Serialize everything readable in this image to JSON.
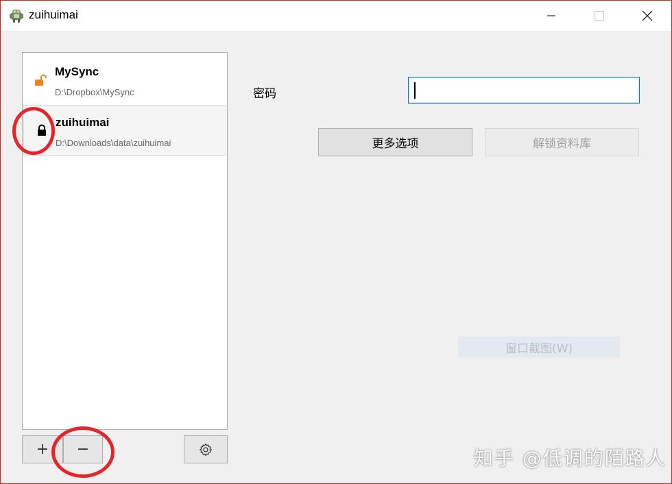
{
  "window": {
    "title": "zuihuimai",
    "border_color": "#c42b1c",
    "icons": {
      "app": "android-robot-icon",
      "minimize": "minimize-icon",
      "maximize": "maximize-icon",
      "close": "close-icon"
    }
  },
  "libraries": [
    {
      "name": "MySync",
      "path": "D:\\Dropbox\\MySync",
      "icon": "unlocked-icon",
      "icon_color": "#e8851c",
      "selected": false
    },
    {
      "name": "zuihuimai",
      "path": "D:\\Downloads\\data\\zuihuimai",
      "icon": "locked-icon",
      "icon_color": "#000000",
      "selected": true
    }
  ],
  "toolbar": {
    "add_label": "+",
    "remove_label": "−",
    "settings_icon": "gear-icon"
  },
  "form": {
    "password_label": "密码",
    "password_value": "",
    "more_options_label": "更多选项",
    "unlock_label": "解锁资料库",
    "accent_color": "#0078d7"
  },
  "overlay": {
    "screenshot_tip": "窗口截图(W)",
    "watermark": "知乎 @低调的陌路人",
    "annotation_color": "#e4262b"
  }
}
